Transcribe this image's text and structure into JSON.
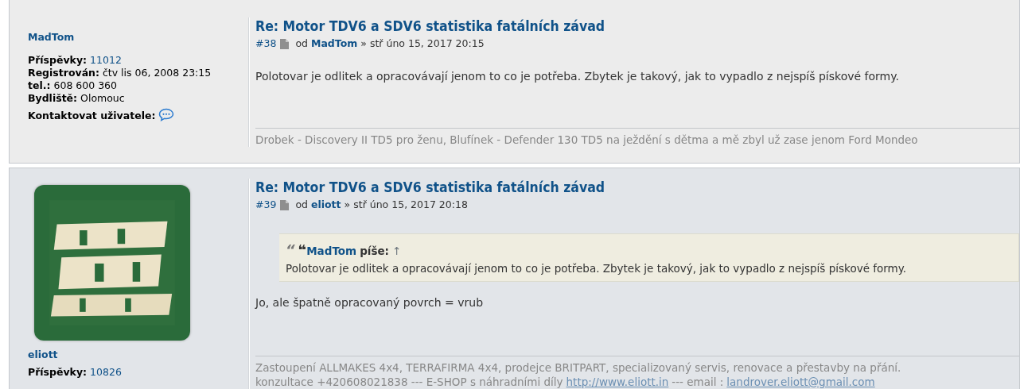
{
  "posts": [
    {
      "author": {
        "name": "MadTom",
        "fields": [
          {
            "label": "Příspěvky:",
            "value": "11012",
            "kind": "link"
          },
          {
            "label": "Registrován:",
            "value": "čtv lis 06, 2008 23:15",
            "kind": "text"
          },
          {
            "label": "tel.:",
            "value": "608 600 360",
            "kind": "text"
          },
          {
            "label": "Bydliště:",
            "value": "Olomouc",
            "kind": "text"
          }
        ],
        "contact": "Kontaktovat uživatele:"
      },
      "title": "Re: Motor TDV6 a SDV6 statistika fatálních závad",
      "number": "#38",
      "by": "od",
      "by_name": "MadTom",
      "sep": "»",
      "date": "stř úno 15, 2017 20:15",
      "content": [
        {
          "kind": "paragraph",
          "text": "Polotovar je odlitek a opracovávají jenom to co je potřeba. Zbytek je takový, jak to vypadlo z nejspíš pískové formy."
        }
      ],
      "signature": [
        [
          {
            "text": "Drobek - Discovery II TD5 pro ženu, Blufínek - Defender 130 TD5 na ježdění s dětma a mě zbyl už zase jenom Ford Mondeo",
            "link": false
          }
        ]
      ]
    },
    {
      "author": {
        "name": "eliott",
        "fields": [
          {
            "label": "Příspěvky:",
            "value": "10826",
            "kind": "link"
          }
        ]
      },
      "title": "Re: Motor TDV6 a SDV6 statistika fatálních závad",
      "number": "#39",
      "by": "od",
      "by_name": "eliott",
      "sep": "»",
      "date": "stř úno 15, 2017 20:18",
      "content": [
        {
          "kind": "quote",
          "marks": [
            "“",
            "❝"
          ],
          "cite": "MadTom",
          "says": "píše:",
          "up": "↑",
          "text": "Polotovar je odlitek a opracovávají jenom to co je potřeba. Zbytek je takový, jak to vypadlo z nejspíš pískové formy."
        },
        {
          "kind": "paragraph",
          "text": "Jo, ale špatně opracovaný povrch = vrub"
        }
      ],
      "signature": [
        [
          {
            "text": "Zastoupení ALLMAKES 4x4, TERRAFIRMA 4x4, prodejce BRITPART, specializovaný servis, renovace a přestavby na přání.",
            "link": false
          }
        ],
        [
          {
            "text": "konzultace +420608021838 --- E-SHOP s náhradními díly",
            "link": false
          },
          {
            "text": "http://www.eliott.in",
            "link": true
          },
          {
            "text": "--- email :",
            "link": false
          },
          {
            "text": "landrover.eliott@gmail.com",
            "link": true
          }
        ]
      ]
    }
  ]
}
